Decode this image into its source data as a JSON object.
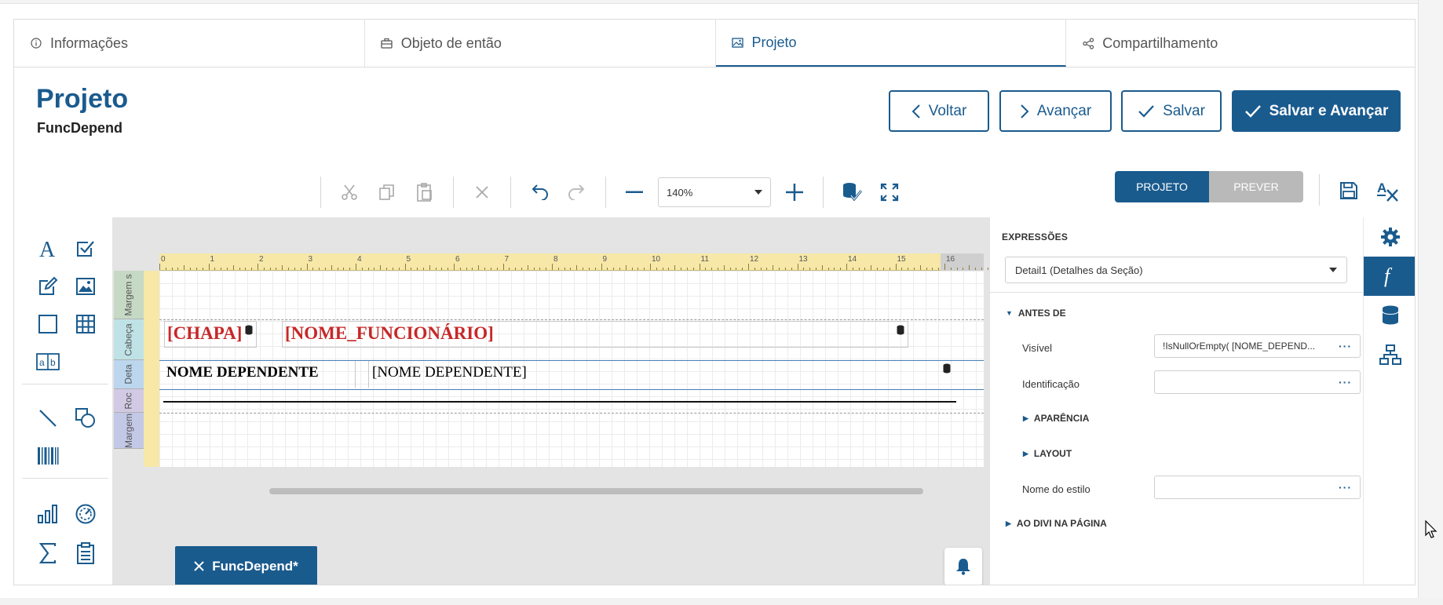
{
  "tabs": [
    {
      "label": "Informações",
      "icon": "info-icon"
    },
    {
      "label": "Objeto de então",
      "icon": "briefcase-icon"
    },
    {
      "label": "Projeto",
      "icon": "image-icon"
    },
    {
      "label": "Compartilhamento",
      "icon": "share-icon"
    }
  ],
  "header": {
    "title": "Projeto",
    "subtitle": "FuncDepend"
  },
  "actions": {
    "back": "Voltar",
    "next": "Avançar",
    "save": "Salvar",
    "save_next": "Salvar e Avançar"
  },
  "toolbar": {
    "zoom": "140%",
    "mode_design": "PROJETO",
    "mode_preview": "PREVER"
  },
  "ruler": {
    "numbers": [
      "0",
      "1",
      "2",
      "3",
      "4",
      "5",
      "6",
      "7",
      "8",
      "9",
      "10",
      "11",
      "12",
      "13",
      "14",
      "15",
      "16"
    ]
  },
  "bands": {
    "top_margin": "Margem s",
    "header": "Cabeça",
    "detail": "Deta",
    "footer": "Roc",
    "bottom_margin": "Margem"
  },
  "report": {
    "chapa": "[CHAPA]",
    "nome_funcionario": "[NOME_FUNCIONÁRIO]",
    "nome_dependente_label": "NOME DEPENDENTE",
    "nome_dependente_field": "[NOME  DEPENDENTE]"
  },
  "report_tab": "FuncDepend*",
  "props": {
    "title": "EXPRESSÕES",
    "selected_band": "Detail1 (Detalhes da Seção)",
    "section_before": "ANTES DE",
    "visible_label": "Visível",
    "visible_value": "!IsNullOrEmpty(  [NOME_DEPEND...",
    "id_label": "Identificação",
    "appearance": "APARÊNCIA",
    "layout": "LAYOUT",
    "style_label": "Nome do estilo",
    "section_page": "AO DIVI NA PÁGINA"
  },
  "colors": {
    "accent": "#1a5b8e",
    "field_red": "#c62828"
  }
}
